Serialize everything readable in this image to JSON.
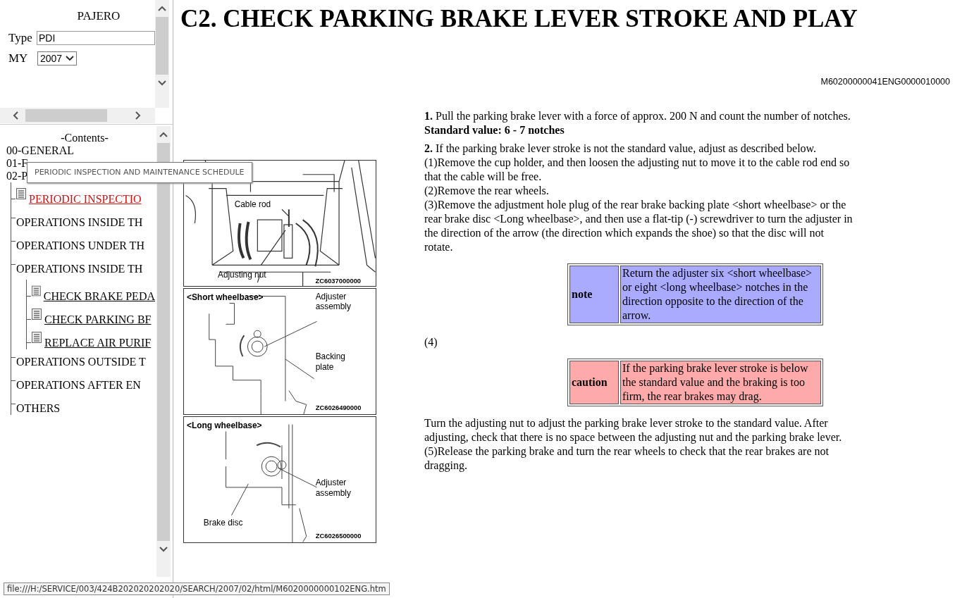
{
  "sidebar": {
    "model": "PAJERO",
    "type_label": "Type",
    "type_value": "PDI",
    "my_label": "MY",
    "my_value": "2007"
  },
  "contents": {
    "title": "-Contents-",
    "items": [
      {
        "label": "00-GENERAL",
        "kind": "chapter"
      },
      {
        "label": "01-F",
        "kind": "chapter"
      },
      {
        "label": "02-P",
        "kind": "chapter",
        "children": [
          {
            "label": "PERIODIC INSPECTIO",
            "kind": "document",
            "selected": true
          },
          {
            "label": "OPERATIONS INSIDE TH",
            "kind": "folder"
          },
          {
            "label": "OPERATIONS UNDER TH",
            "kind": "folder"
          },
          {
            "label": "OPERATIONS INSIDE TH",
            "kind": "folder",
            "children": [
              {
                "label": "CHECK BRAKE PEDA",
                "kind": "document",
                "selected": false
              },
              {
                "label": "CHECK PARKING BF",
                "kind": "document",
                "selected": false
              },
              {
                "label": "REPLACE AIR PURIF",
                "kind": "document",
                "selected": false
              }
            ]
          },
          {
            "label": "OPERATIONS OUTSIDE T",
            "kind": "folder"
          },
          {
            "label": "OPERATIONS AFTER EN",
            "kind": "folder"
          },
          {
            "label": "OTHERS",
            "kind": "folder"
          }
        ]
      }
    ]
  },
  "tooltip": "PERIODIC INSPECTION AND MAINTENANCE SCHEDULE",
  "page": {
    "title": "C2. CHECK PARKING BRAKE LEVER STROKE AND PLAY",
    "doc_code": "M60200000041ENG0000010000",
    "figures": [
      {
        "kind": "cable",
        "labels": [
          "Cable rod",
          "Adjusting nut"
        ],
        "code": "ZC6037000000"
      },
      {
        "kind": "short",
        "heading": "<Short wheelbase>",
        "labels": [
          "Adjuster\nassembly",
          "Backing\nplate"
        ],
        "code": "ZC6026490000"
      },
      {
        "kind": "long",
        "heading": "<Long wheelbase>",
        "labels": [
          "Adjuster\nassembly",
          "Brake disc"
        ],
        "code": "ZC6026500000"
      }
    ],
    "blocks": [
      {
        "kind": "para",
        "text": "**1.** Pull the parking brake lever with a force of approx. 200 N and count the number of notches."
      },
      {
        "kind": "value",
        "text": "Standard value: 6 - 7 notches"
      },
      {
        "kind": "para",
        "text": "**2.** If the parking brake lever stroke is not the standard value, adjust as described below."
      },
      {
        "kind": "line",
        "text": "(1)Remove the cup holder, and then loosen the adjusting nut to move it to the cable rod end so that the cable will be free."
      },
      {
        "kind": "line",
        "text": "(2)Remove the rear wheels."
      },
      {
        "kind": "line",
        "text": "(3)Remove the adjustment hole plug of the rear brake backing plate <short wheelbase> or the rear brake disc <Long wheelbase>, and then use a flat-tip (-) screwdriver to turn the adjuster in the direction of the arrow (the direction which expands the shoe) so that the disc will not rotate."
      },
      {
        "kind": "callout",
        "label": "note",
        "color": "#aaaaff",
        "text": "Return the adjuster six <short wheelbase> or eight <long wheelbase> notches in the direction opposite to the direction of the arrow."
      },
      {
        "kind": "line",
        "text": "(4)"
      },
      {
        "kind": "callout",
        "label": "caution",
        "color": "#ffaaaa",
        "text": "If the parking brake lever stroke is below the standard value and the braking is too firm, the rear brakes may drag."
      },
      {
        "kind": "line",
        "text": "Turn the adjusting nut to adjust the parking brake lever stroke to the standard value. After adjusting, check that there is no space between the adjusting nut and the parking brake lever."
      },
      {
        "kind": "line",
        "text": "(5)Release the parking brake and turn the rear wheels to check that the rear brakes are not dragging."
      }
    ]
  },
  "status_url": "file:///H:/SERVICE/003/424B202020202020/SEARCH/2007/02/html/M6020000000102ENG.htm"
}
